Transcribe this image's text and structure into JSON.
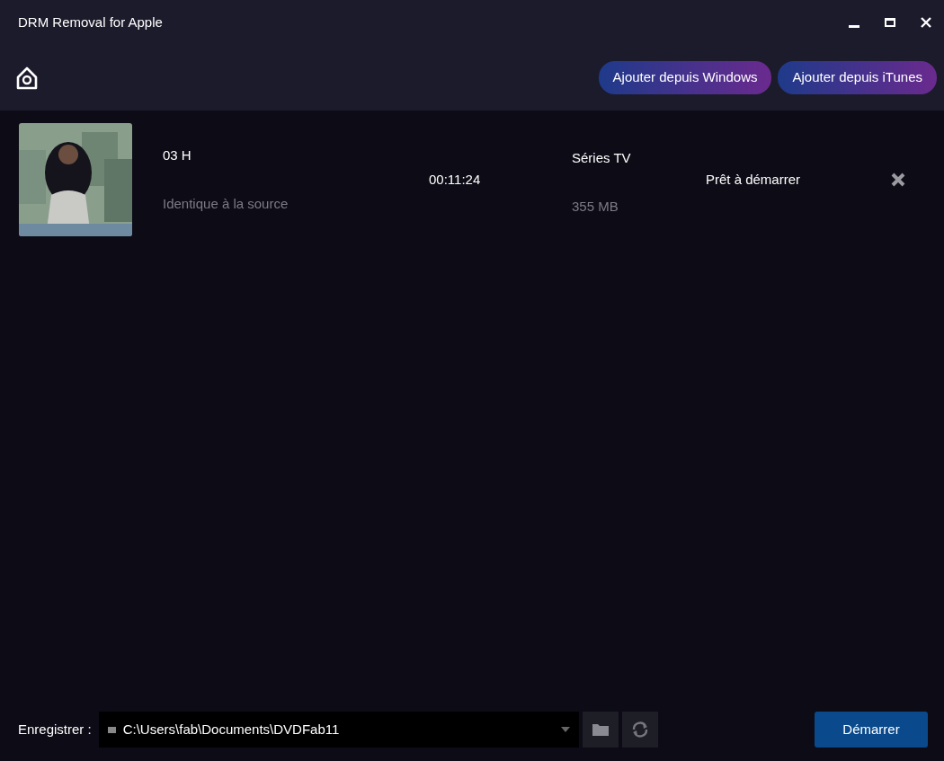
{
  "window": {
    "title": "DRM Removal for Apple"
  },
  "toolbar": {
    "buttons": [
      "Ajouter depuis Windows",
      "Ajouter depuis iTunes"
    ]
  },
  "items": [
    {
      "kind": "picture",
      "title": "03 H",
      "quality": "Identique à la source",
      "duration": "00:11:24",
      "category": "Séries TV",
      "size": "355 MB",
      "status": "Prêt à démarrer"
    }
  ],
  "footer": {
    "label": "Enregistrer :",
    "path": "C:\\Users\\fab\\Documents\\DVDFab11",
    "start_button": "Démarrer"
  }
}
